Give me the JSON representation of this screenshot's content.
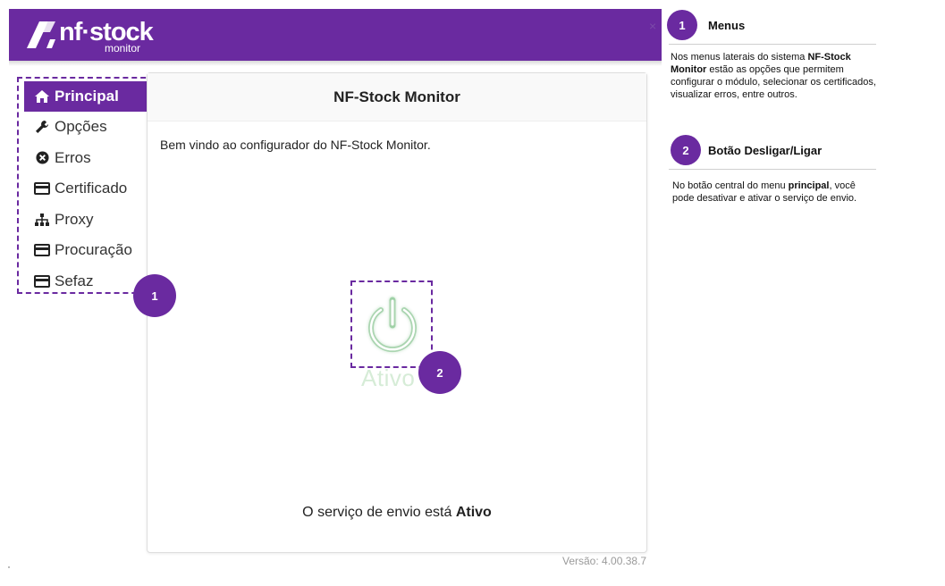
{
  "header": {
    "logo_main": "nf·stock",
    "logo_sub": "monitor",
    "close_glyph": "×",
    "brand_color": "#6a2aa0"
  },
  "sidebar": {
    "items": [
      {
        "label": "Principal",
        "icon": "home-icon",
        "active": true
      },
      {
        "label": "Opções",
        "icon": "wrench-icon",
        "active": false
      },
      {
        "label": "Erros",
        "icon": "error-circle-icon",
        "active": false
      },
      {
        "label": "Certificado",
        "icon": "card-icon",
        "active": false
      },
      {
        "label": "Proxy",
        "icon": "sitemap-icon",
        "active": false
      },
      {
        "label": "Procuração",
        "icon": "card-icon",
        "active": false
      },
      {
        "label": "Sefaz",
        "icon": "card-icon",
        "active": false
      }
    ]
  },
  "main": {
    "title": "NF-Stock Monitor",
    "welcome": "Bem vindo ao configurador do NF-Stock Monitor.",
    "power_label": "Ativo",
    "status_prefix": "O serviço de envio está",
    "status_value": "Ativo",
    "version": "Versão: 4.00.38.7",
    "power_color": "#6dbb7a"
  },
  "callouts": {
    "badge1": "1",
    "badge2": "2"
  },
  "notes": [
    {
      "number": "1",
      "title": "Menus",
      "text_before": "Nos menus laterais do sistema ",
      "bold": "NF-Stock Monitor",
      "text_after": " estão as opções que permitem configurar o módulo, selecionar os certificados, visualizar erros, entre outros."
    },
    {
      "number": "2",
      "title": "Botão Desligar/Ligar",
      "text_before": "No botão central do menu ",
      "bold": "principal",
      "text_after": ", você pode desativar e ativar o serviço de envio."
    }
  ]
}
